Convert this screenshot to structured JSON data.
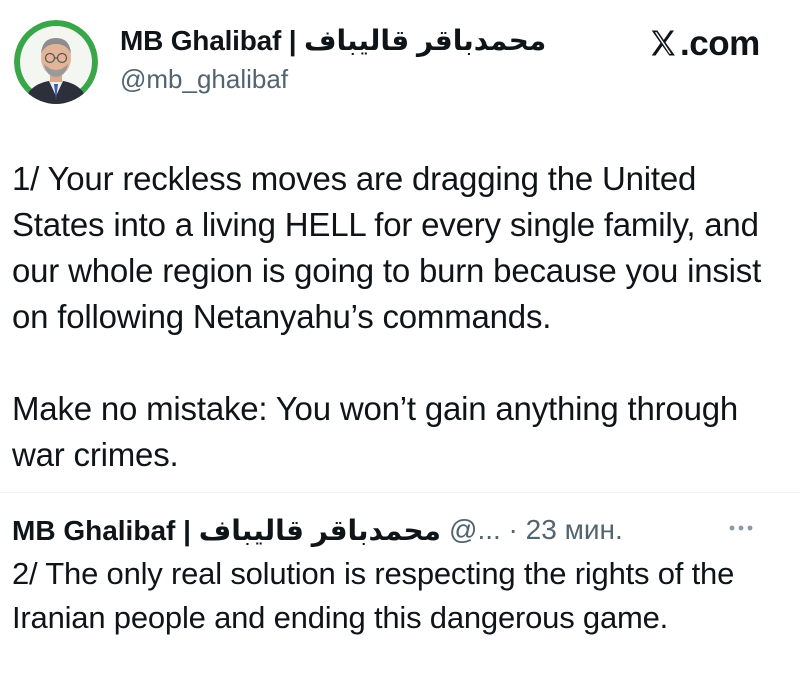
{
  "header": {
    "display_name": "MB Ghalibaf | محمدباقر قالیباف",
    "handle": "@mb_ghalibaf",
    "site_label": ".com",
    "avatar_icon": "profile-photo"
  },
  "tweet": {
    "paragraph_1": "1/ Your reckless moves are dragging the United States into a living HELL for every single family, and our whole region is going to burn because you insist on following Netanyahu’s commands.",
    "paragraph_2": "Make no mistake: You won’t gain anything through war crimes."
  },
  "reply": {
    "display_name": "MB Ghalibaf | محمدباقر قالیباف",
    "meta": "@... · 23 мин.",
    "more_label": "···",
    "text": "2/ The only real solution is respecting the rights of the Iranian people and ending this dangerous game."
  },
  "colors": {
    "text": "#0f1419",
    "secondary": "#536471",
    "avatar_ring": "#3aa64a"
  }
}
